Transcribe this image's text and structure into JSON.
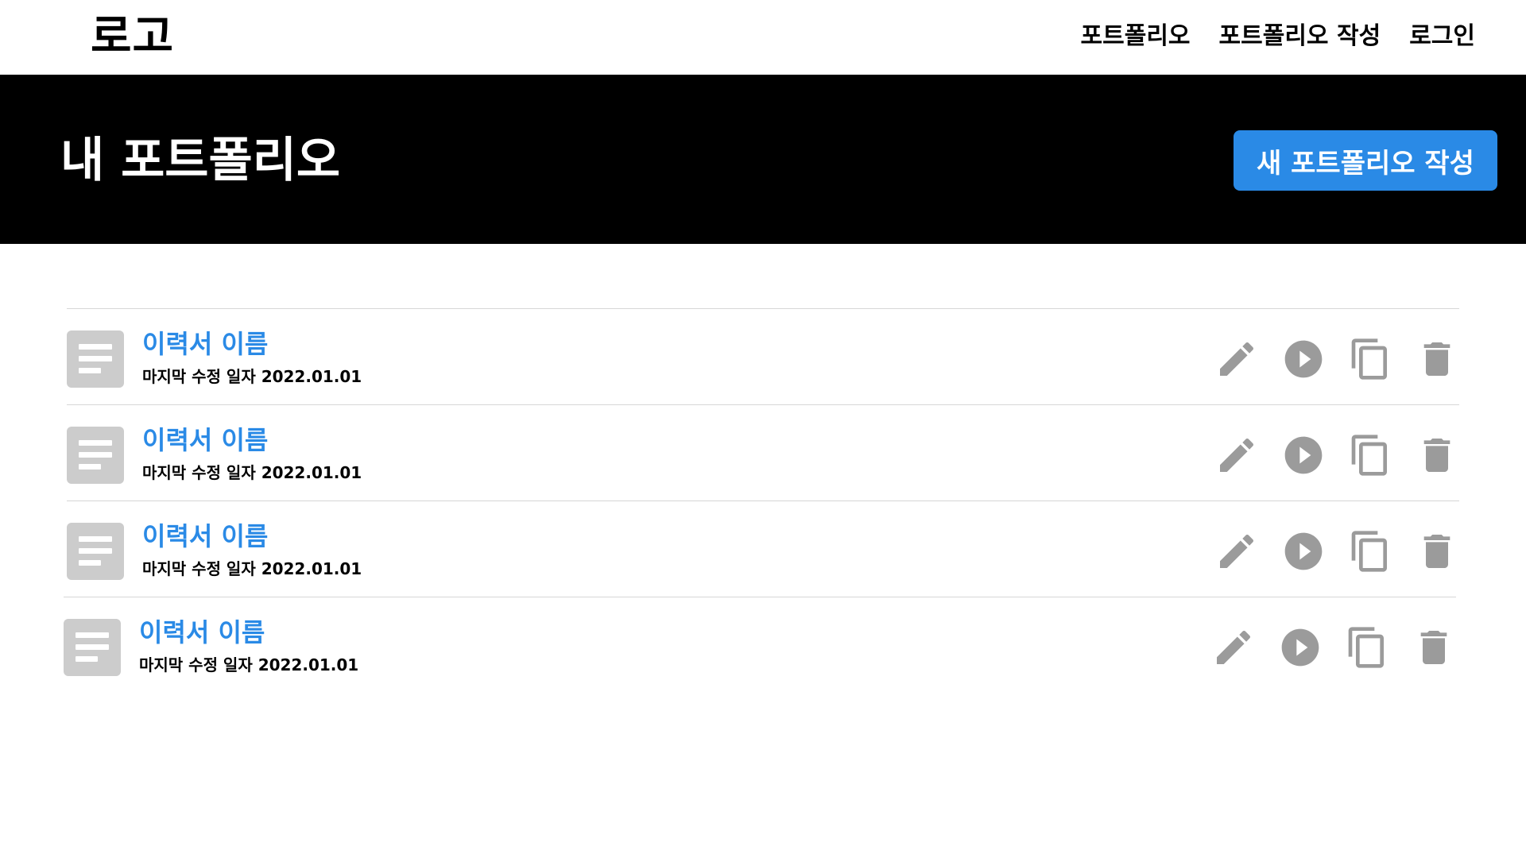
{
  "header": {
    "logo": "로고",
    "nav": [
      "포트폴리오",
      "포트폴리오 작성",
      "로그인"
    ]
  },
  "hero": {
    "title": "내 포트폴리오",
    "new_button": "새 포트폴리오 작성"
  },
  "portfolios": [
    {
      "title": "이력서 이름",
      "meta": "마지막 수정 일자 2022.01.01"
    },
    {
      "title": "이력서 이름",
      "meta": "마지막 수정 일자 2022.01.01"
    },
    {
      "title": "이력서 이름",
      "meta": "마지막 수정 일자 2022.01.01"
    },
    {
      "title": "이력서 이름",
      "meta": "마지막 수정 일자 2022.01.01"
    }
  ],
  "icons": {
    "document": "document-icon",
    "edit": "pencil-icon",
    "preview": "play-icon",
    "copy": "copy-icon",
    "delete": "trash-icon"
  },
  "colors": {
    "accent": "#2a8ae6",
    "hero_bg": "#000000",
    "icon_gray": "#9b9b9b",
    "doc_gray": "#cccccc"
  }
}
